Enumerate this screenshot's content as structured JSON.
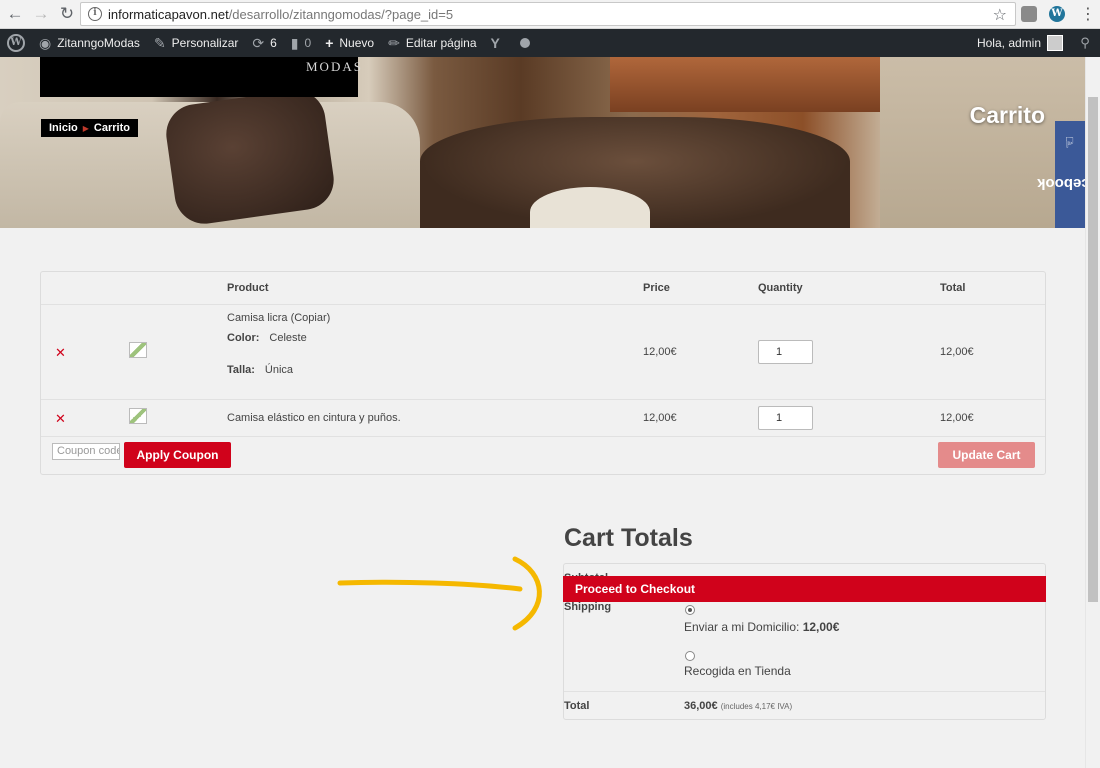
{
  "browser": {
    "url_host": "informaticapavon.net",
    "url_path": "/desarrollo/zitanngomodas/?page_id=5"
  },
  "adminbar": {
    "site_name": "ZitanngoModas",
    "customize": "Personalizar",
    "updates_count": "6",
    "comments_count": "0",
    "new_label": "Nuevo",
    "edit_page": "Editar página",
    "greeting": "Hola, admin"
  },
  "hero": {
    "logo_text": "MODAS",
    "breadcrumb_home": "Inicio",
    "breadcrumb_current": "Carrito",
    "title": "Carrito",
    "facebook_label": "facebook"
  },
  "cart": {
    "headers": {
      "product": "Product",
      "price": "Price",
      "quantity": "Quantity",
      "total": "Total"
    },
    "items": [
      {
        "name": "Camisa licra (Copiar)",
        "color_label": "Color:",
        "color_value": "Celeste",
        "size_label": "Talla:",
        "size_value": "Única",
        "price": "12,00€",
        "quantity": "1",
        "total": "12,00€"
      },
      {
        "name": "Camisa elástico en cintura y puños.",
        "price": "12,00€",
        "quantity": "1",
        "total": "12,00€"
      }
    ],
    "coupon_placeholder": "Coupon code",
    "apply_coupon": "Apply Coupon",
    "update_cart": "Update Cart"
  },
  "totals": {
    "title": "Cart Totals",
    "subtotal_label": "Subtotal",
    "proceed_checkout": "Proceed to Checkout",
    "shipping_label": "Shipping",
    "shipping_option_1": "Enviar a mi Domicilio:",
    "shipping_option_1_price": "12,00€",
    "shipping_option_2": "Recogida en Tienda",
    "total_label": "Total",
    "total_value": "36,00€",
    "total_tax_note": "(includes 4,17€ IVA)"
  },
  "colors": {
    "accent_red": "#d0021b",
    "admin_bar": "#23282d",
    "facebook_blue": "#3b5998",
    "annotation_arrow": "#f5b800"
  }
}
